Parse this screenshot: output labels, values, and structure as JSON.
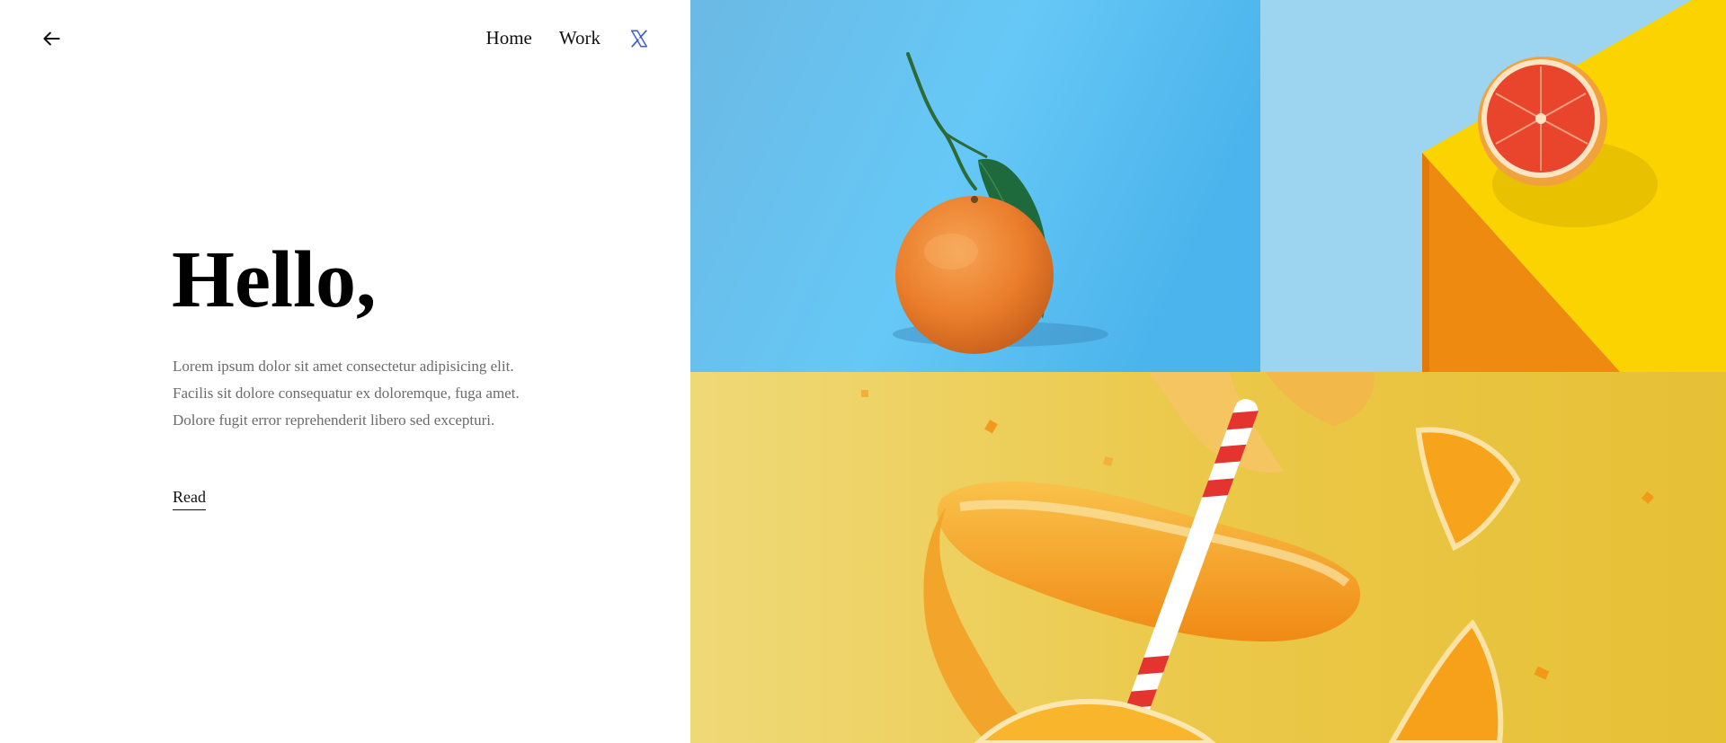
{
  "nav": {
    "back_icon": "arrow-left-icon",
    "home": "Home",
    "work": "Work",
    "social_icon": "x-twitter-icon",
    "social_color": "#3b5bd6"
  },
  "hero": {
    "title": "Hello,",
    "body": "Lorem ipsum dolor sit amet consectetur adipisicing elit. Facilis sit dolore consequatur ex doloremque, fuga amet. Dolore fugit error reprehenderit libero sed excepturi.",
    "read": "Read"
  },
  "gallery": {
    "images": [
      {
        "subject": "tangerine with leaf on blue background",
        "color": "#5cbfee"
      },
      {
        "subject": "halved grapefruit on yellow block",
        "color": "#fbd400"
      },
      {
        "subject": "orange peel and slices with striped straw",
        "color": "#ecc94b"
      }
    ]
  }
}
